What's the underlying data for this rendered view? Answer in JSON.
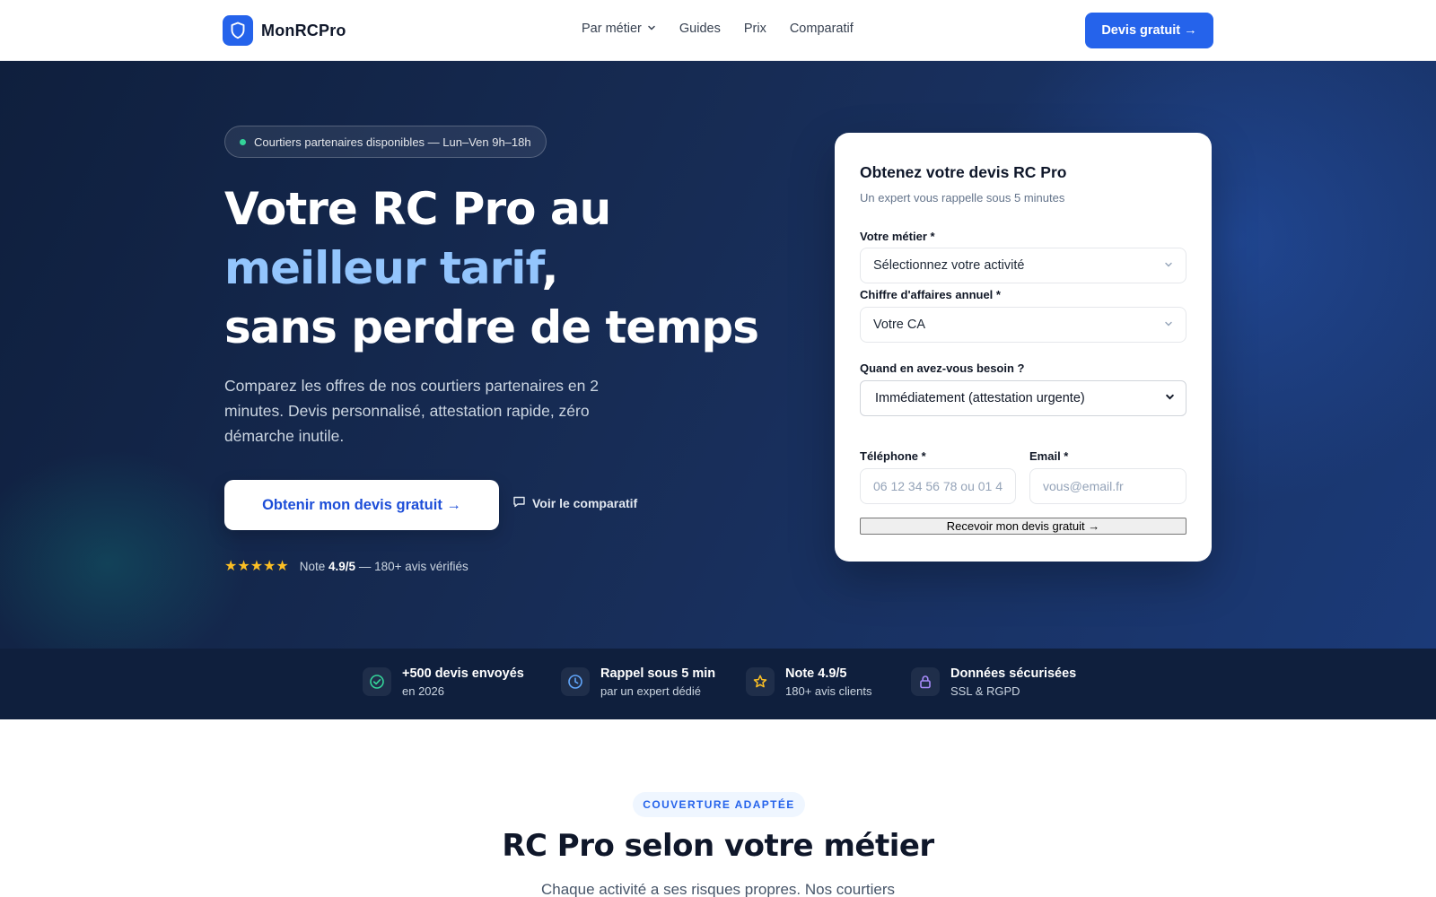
{
  "header": {
    "logo_text": "MonRCPro",
    "nav": [
      {
        "label": "Par métier",
        "has_dropdown": true
      },
      {
        "label": "Guides"
      },
      {
        "label": "Prix"
      },
      {
        "label": "Comparatif"
      }
    ],
    "cta_label": "Devis gratuit →"
  },
  "hero": {
    "badge": "Courtiers partenaires disponibles — Lun–Ven 9h–18h",
    "title_line1": "Votre RC Pro au",
    "title_accent": "meilleur tarif",
    "title_comma": ",",
    "title_line3": "sans perdre de temps",
    "subtitle": "Comparez les offres de nos courtiers partenaires en 2 minutes. Devis personnalisé, attestation rapide, zéro démarche inutile.",
    "primary_cta": "Obtenir mon devis gratuit →",
    "secondary_cta": "Voir le comparatif",
    "rating": {
      "stars": "★★★★★",
      "prefix": "Note",
      "score": "4.9/5",
      "suffix": "— 180+ avis vérifiés",
      "value": 5
    }
  },
  "form": {
    "title": "Obtenez votre devis RC Pro",
    "subtitle": "Un expert vous rappelle sous 5 minutes",
    "metier_label": "Votre métier *",
    "metier_value": "Sélectionnez votre activité",
    "ca_label": "Chiffre d'affaires annuel *",
    "ca_value": "Votre CA",
    "besoin_label": "Quand en avez-vous besoin ?",
    "besoin_value": "Immédiatement (attestation urgente)",
    "phone_label": "Téléphone *",
    "phone_placeholder": "06 12 34 56 78 ou 01 4",
    "email_label": "Email *",
    "email_placeholder": "vous@email.fr",
    "submit_label": "Recevoir mon devis gratuit →"
  },
  "stats": [
    {
      "title": "+500 devis envoyés",
      "desc": "en 2026",
      "icon": "check-circle-icon",
      "color": "#34d399"
    },
    {
      "title": "Rappel sous 5 min",
      "desc": "par un expert dédié",
      "icon": "clock-icon",
      "color": "#60a5fa"
    },
    {
      "title": "Note 4.9/5",
      "desc": "180+ avis clients",
      "icon": "star-icon",
      "color": "#fbbf24"
    },
    {
      "title": "Données sécurisées",
      "desc": "SSL & RGPD",
      "icon": "lock-icon",
      "color": "#a78bfa"
    }
  ],
  "section": {
    "pill": "COUVERTURE ADAPTÉE",
    "title": "RC Pro selon votre métier",
    "subtitle": "Chaque activité a ses risques propres. Nos courtiers"
  },
  "colors": {
    "brand": "#2563eb",
    "hero_dark": "#0f1f3d",
    "accent_text": "#93c5fd"
  }
}
